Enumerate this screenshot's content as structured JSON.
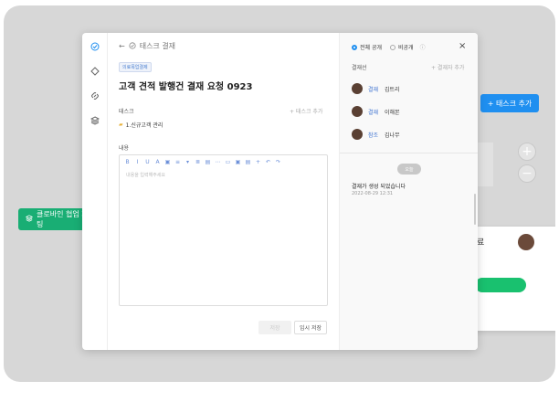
{
  "background": {
    "add_task_label": "+ 태스크 추가",
    "collab_label": "클로바인 협업 채팅",
    "card_text": "료",
    "plus_symbol": "+",
    "minus_symbol": "−"
  },
  "rail": {
    "icons": [
      "check-circle-icon",
      "diamond-icon",
      "link-icon",
      "layers-icon"
    ]
  },
  "header": {
    "back_label": "태스크 결재"
  },
  "tag_label": "의료목업결제",
  "title": "고객 견적 발행건 결재 요청 0923",
  "task": {
    "label": "태스크",
    "add_label": "+ 태스크 추가",
    "item": "1.신규고객 관리"
  },
  "content": {
    "label": "내용",
    "placeholder": "내용을 입력해주세요",
    "toolbar": [
      "B",
      "I",
      "U",
      "A",
      "▣",
      "≡",
      "▾",
      "≣",
      "▤",
      "⋯",
      "▭",
      "▣",
      "▤",
      "+",
      "↶",
      "↷"
    ]
  },
  "buttons": {
    "save": "저장",
    "temp_save": "임시 저장"
  },
  "visibility": {
    "public": "전체 공개",
    "private": "비공개",
    "close": "×"
  },
  "approval": {
    "label": "결재선",
    "add_label": "+ 결재자 추가",
    "rows": [
      {
        "role": "결재",
        "name": "김트리"
      },
      {
        "role": "결재",
        "name": "이해본"
      },
      {
        "role": "참조",
        "name": "김나무"
      }
    ]
  },
  "activity": {
    "today": "오늘",
    "message": "결재가 생성 되었습니다",
    "date": "2022-08-29 12:31"
  }
}
